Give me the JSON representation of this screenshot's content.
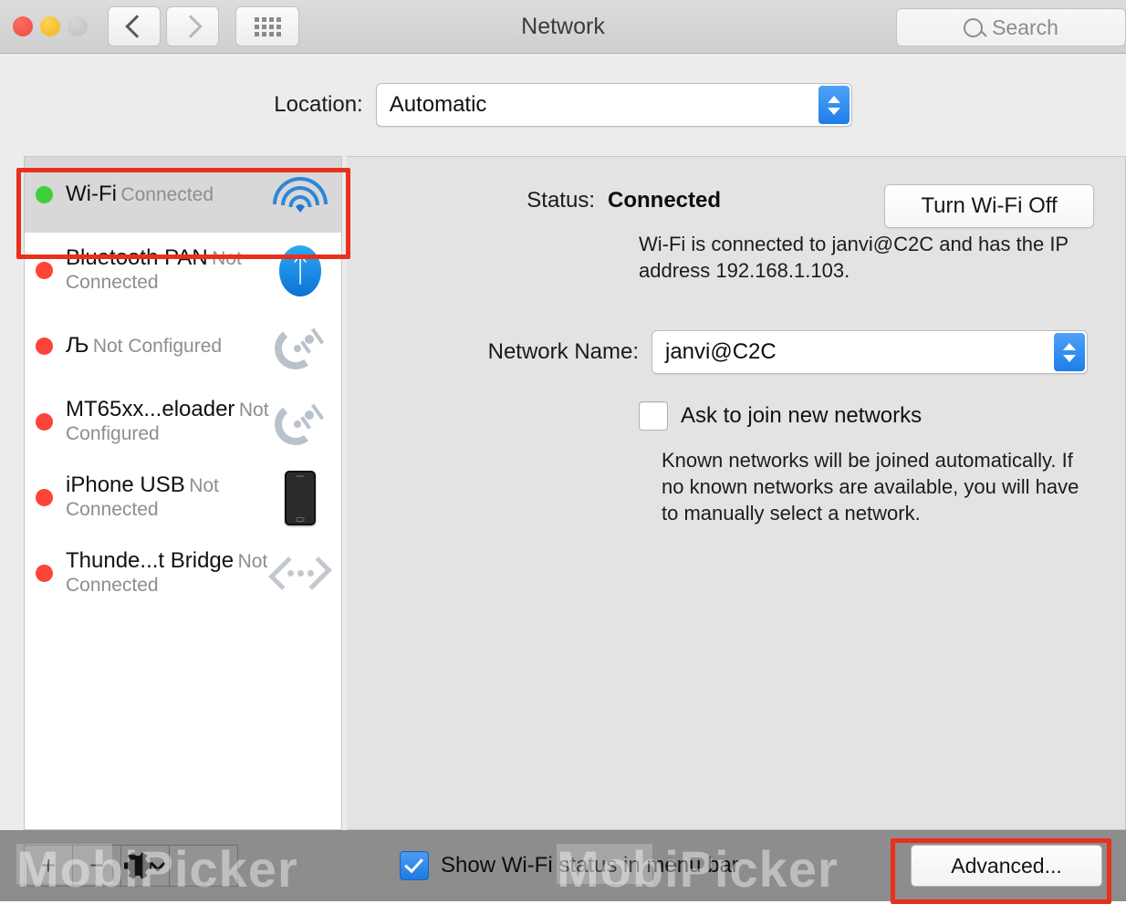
{
  "window": {
    "title": "Network",
    "traffic_lights": [
      "close",
      "minimize",
      "zoom"
    ],
    "back_icon": "chevron-left-icon",
    "forward_icon": "chevron-right-icon",
    "grid_icon": "grid-view-icon"
  },
  "search": {
    "placeholder": "Search",
    "icon": "search-icon"
  },
  "location": {
    "label": "Location:",
    "value": "Automatic",
    "options": [
      "Automatic"
    ]
  },
  "sidebar": {
    "items": [
      {
        "name": "Wi-Fi",
        "status": "Connected",
        "dot": "green",
        "dot_color": "#3fcf3a",
        "icon": "wifi-icon",
        "selected": true
      },
      {
        "name": "Bluetooth PAN",
        "status": "Not Connected",
        "dot": "red",
        "dot_color": "#fc4438",
        "icon": "bluetooth-icon",
        "selected": false
      },
      {
        "name": "Љ",
        "status": "Not Configured",
        "dot": "red",
        "dot_color": "#fc4438",
        "icon": "modem-icon",
        "selected": false
      },
      {
        "name": "MT65xx...eloader",
        "status": "Not Configured",
        "dot": "red",
        "dot_color": "#fc4438",
        "icon": "modem-icon",
        "selected": false
      },
      {
        "name": "iPhone USB",
        "status": "Not Connected",
        "dot": "red",
        "dot_color": "#fc4438",
        "icon": "iphone-icon",
        "selected": false
      },
      {
        "name": "Thunde...t Bridge",
        "status": "Not Connected",
        "dot": "red",
        "dot_color": "#fc4438",
        "icon": "thunderbolt-icon",
        "selected": false
      }
    ],
    "footer": {
      "add_label": "+",
      "remove_label": "−",
      "gear_icon": "gear-icon",
      "chevron_icon": "chevron-down-icon"
    }
  },
  "panel": {
    "status_label": "Status:",
    "status_value": "Connected",
    "turn_off_button": "Turn Wi-Fi Off",
    "description": "Wi-Fi is connected to janvi@C2C and has the IP address 192.168.1.103.",
    "network_name_label": "Network Name:",
    "network_name_value": "janvi@C2C",
    "ask_join_label": "Ask to join new networks",
    "ask_join_checked": false,
    "known_networks_text": "Known networks will be joined automatically. If no known networks are available, you will have to manually select a network."
  },
  "bottom": {
    "show_status_label": "Show Wi-Fi status in menu bar",
    "show_status_checked": true,
    "advanced_button": "Advanced..."
  },
  "annotations": {
    "color": "#e8301a",
    "targets": [
      "wifi-sidebar-row",
      "advanced-button"
    ]
  },
  "watermark": {
    "text": "MobiPicker"
  }
}
